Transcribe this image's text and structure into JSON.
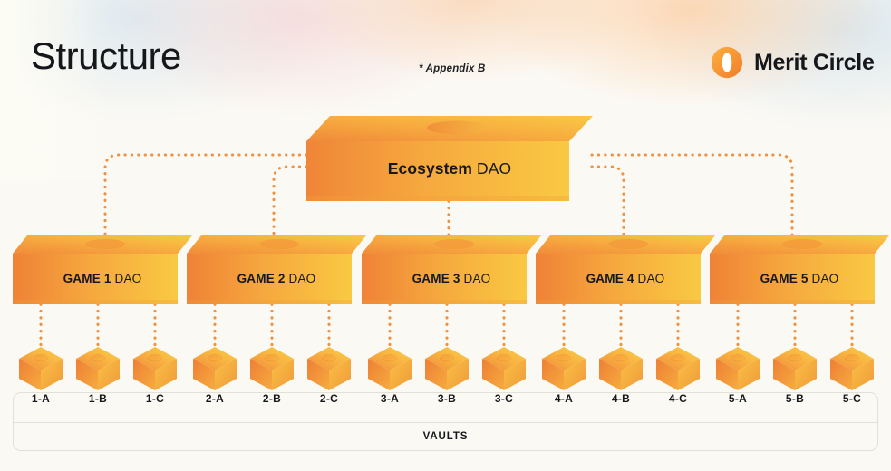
{
  "header": {
    "title": "Structure",
    "appendix_note": "* Appendix B",
    "brand": "Merit Circle",
    "brand_icon": "merit-circle-logo-icon"
  },
  "colors": {
    "background": "#fbf9f4",
    "box_top_light": "#f9c44a",
    "box_front_start": "#f0873a",
    "box_front_end": "#f8c63f",
    "connector": "#f0913f",
    "text": "#16181b",
    "frame_border": "#e3e0d8"
  },
  "root": {
    "name_bold": "Ecosystem",
    "name_regular": "DAO"
  },
  "dao_nodes": [
    {
      "name_bold": "GAME 1",
      "name_regular": "DAO"
    },
    {
      "name_bold": "GAME 2",
      "name_regular": "DAO"
    },
    {
      "name_bold": "GAME 3",
      "name_regular": "DAO"
    },
    {
      "name_bold": "GAME 4",
      "name_regular": "DAO"
    },
    {
      "name_bold": "GAME 5",
      "name_regular": "DAO"
    }
  ],
  "vaults": {
    "caption": "VAULTS",
    "items": [
      {
        "label": "1-A"
      },
      {
        "label": "1-B"
      },
      {
        "label": "1-C"
      },
      {
        "label": "2-A"
      },
      {
        "label": "2-B"
      },
      {
        "label": "2-C"
      },
      {
        "label": "3-A"
      },
      {
        "label": "3-B"
      },
      {
        "label": "3-C"
      },
      {
        "label": "4-A"
      },
      {
        "label": "4-B"
      },
      {
        "label": "4-C"
      },
      {
        "label": "5-A"
      },
      {
        "label": "5-B"
      },
      {
        "label": "5-C"
      }
    ]
  }
}
